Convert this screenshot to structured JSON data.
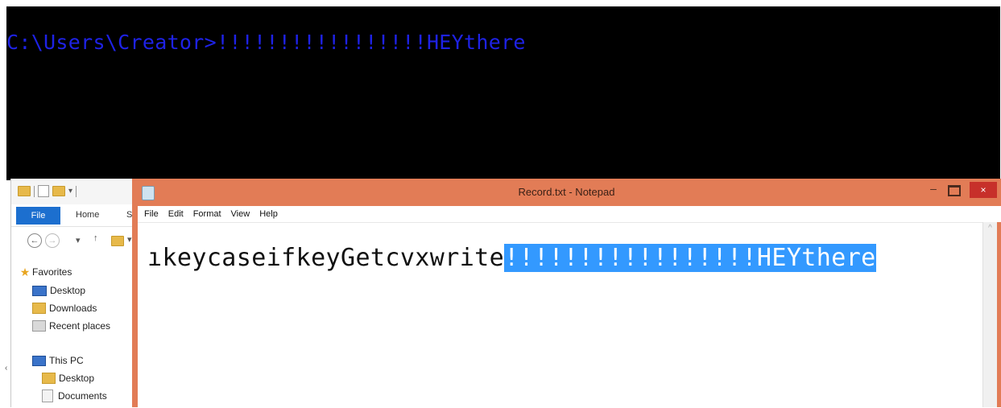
{
  "console": {
    "prompt": "C:\\Users\\Creator>",
    "input": "!!!!!!!!!!!!!!!!!HEYthere"
  },
  "explorer": {
    "ribbon_tabs": {
      "file": "File",
      "home": "Home",
      "partial": "S"
    },
    "nav_pane": {
      "favorites": "Favorites",
      "favorite_items": [
        "Desktop",
        "Downloads",
        "Recent places"
      ],
      "this_pc": "This PC",
      "pc_items": [
        "Desktop",
        "Documents"
      ]
    }
  },
  "notepad": {
    "title": "Record.txt - Notepad",
    "menu": [
      "File",
      "Edit",
      "Format",
      "View",
      "Help"
    ],
    "text_before_selection": "ıkeycaseifkeyGetcvxwrite",
    "selected_text": "!!!!!!!!!!!!!!!!!HEYthere",
    "close_label": "×",
    "minimize_label": "–"
  },
  "colors": {
    "console_text": "#1e22e6",
    "notepad_frame": "#e27c56",
    "selection": "#3399ff",
    "close_button": "#c7302a",
    "file_tab": "#1c6fcf"
  }
}
